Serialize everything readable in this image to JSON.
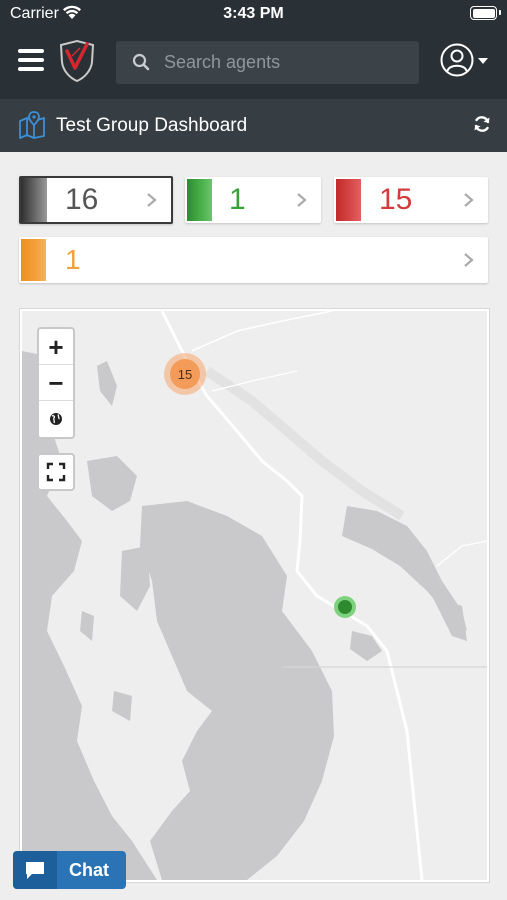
{
  "status_bar": {
    "carrier": "Carrier",
    "time": "3:43 PM"
  },
  "nav": {
    "search_placeholder": "Search agents",
    "icons": {
      "menu": "hamburger-icon",
      "logo": "brand-logo",
      "search": "search-icon",
      "user": "user-avatar-icon",
      "caret": "caret-down-icon"
    }
  },
  "dashboard": {
    "title": "Test Group Dashboard",
    "icons": {
      "title": "map-icon",
      "refresh": "refresh-icon"
    }
  },
  "status_cards": [
    {
      "count": "16",
      "status": "all",
      "color": "#3a3a3a"
    },
    {
      "count": "1",
      "status": "healthy",
      "color": "#3aa13a"
    },
    {
      "count": "15",
      "status": "critical",
      "color": "#d13c3c"
    },
    {
      "count": "1",
      "status": "warning",
      "color": "#f0a23a"
    }
  ],
  "map": {
    "controls": {
      "zoom_in": "+",
      "zoom_out": "−"
    },
    "cluster": {
      "count": "15",
      "color": "#f39c5a"
    },
    "marker": {
      "color": "#2f8a2f"
    }
  },
  "chat": {
    "label": "Chat",
    "color": "#2a74b5"
  }
}
